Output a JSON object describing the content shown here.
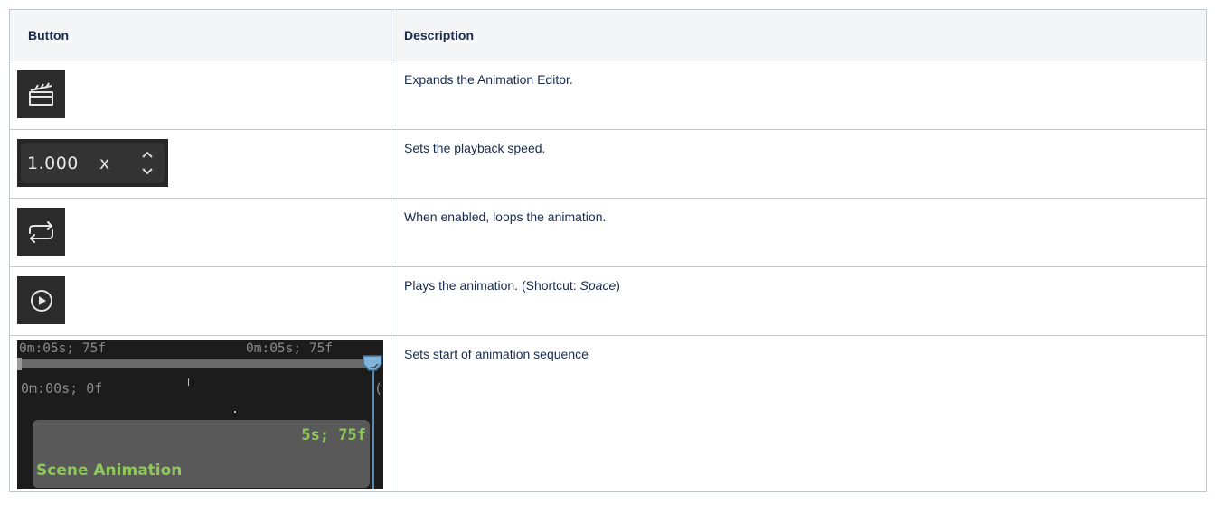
{
  "table": {
    "headers": {
      "button": "Button",
      "description": "Description"
    },
    "rows": [
      {
        "icon": "clapperboard-icon",
        "description": "Expands the Animation Editor."
      },
      {
        "icon": "playback-speed-spinner",
        "speed_value": "1.000",
        "speed_unit": "x",
        "description": "Sets the playback speed."
      },
      {
        "icon": "loop-icon",
        "description": "When enabled, loops the animation."
      },
      {
        "icon": "play-circle-icon",
        "description_prefix": "Plays the animation. (Shortcut: ",
        "description_key": "Space",
        "description_suffix": ")"
      },
      {
        "icon": "timeline-start-marker",
        "description": "Sets start of animation sequence",
        "timeline": {
          "range_start": "0m:05s; 75f",
          "range_end": "0m:05s; 75f",
          "track_time": "0m:00s; 0f",
          "edge_label": "(",
          "clip_duration": "5s; 75f",
          "clip_name": "Scene Animation"
        }
      }
    ]
  },
  "colors": {
    "header_bg": "#f4f5f7",
    "border": "#c1c7d0",
    "icon_tile_bg": "#2b2b2b",
    "clip_text": "#8cc85a",
    "playhead": "#5a8bb0"
  }
}
